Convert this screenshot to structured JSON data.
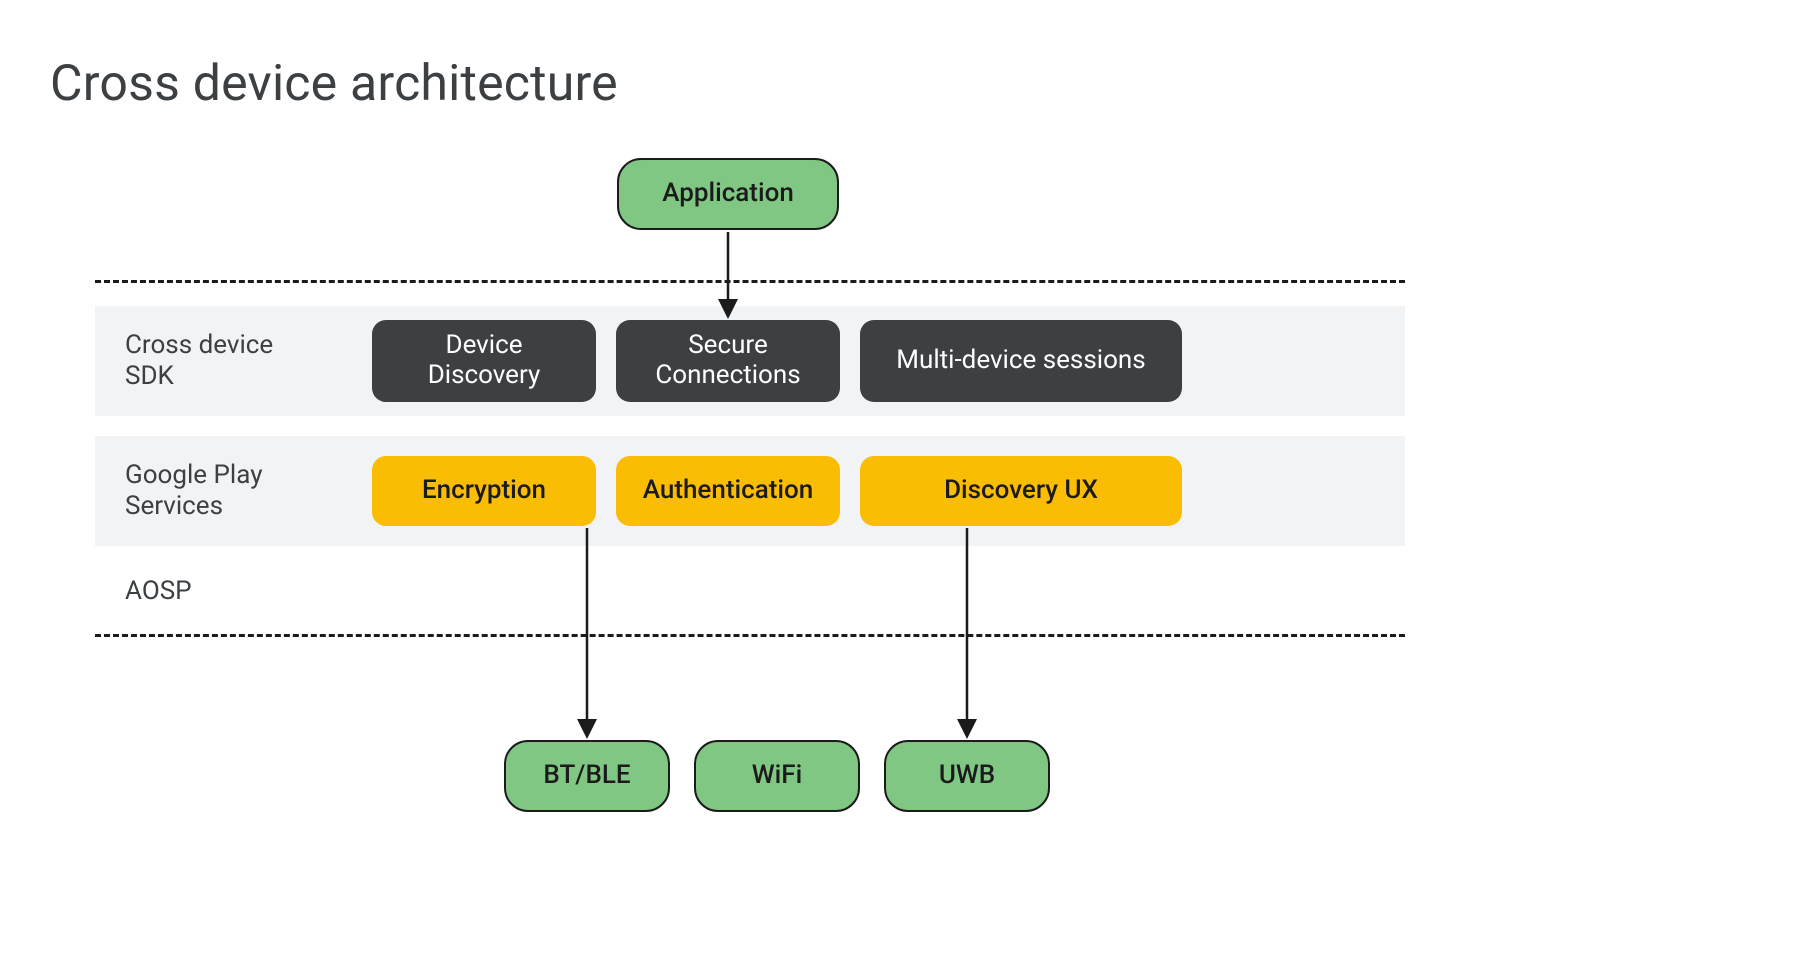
{
  "title": "Cross device architecture",
  "nodes": {
    "application": "Application",
    "device_discovery": "Device Discovery",
    "secure_connections": "Secure Connections",
    "multi_device_sessions": "Multi-device sessions",
    "encryption": "Encryption",
    "authentication": "Authentication",
    "discovery_ux": "Discovery UX",
    "bt_ble": "BT/BLE",
    "wifi": "WiFi",
    "uwb": "UWB"
  },
  "labels": {
    "sdk": "Cross device SDK",
    "play": "Google Play Services",
    "aosp": "AOSP"
  },
  "colors": {
    "green": "#81c784",
    "dark": "#3c4043",
    "amber": "#fbbc04",
    "band": "#f1f3f4"
  }
}
